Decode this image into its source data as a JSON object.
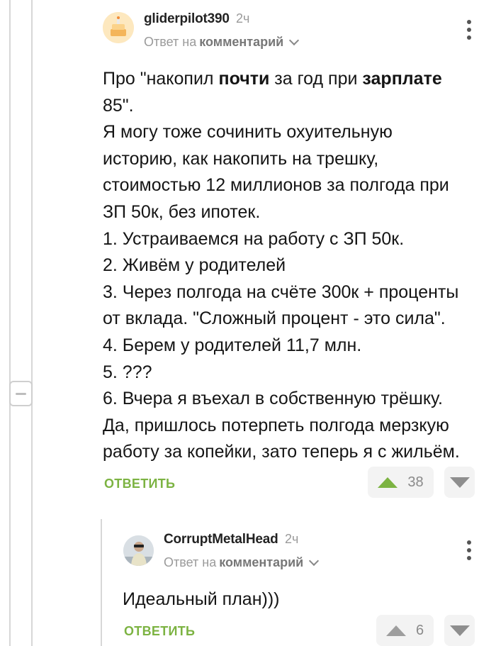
{
  "comment1": {
    "username": "gliderpilot390",
    "time": "2ч",
    "reply_prefix": "Ответ на",
    "reply_target": "комментарий",
    "body_lines": [
      {
        "parts": [
          {
            "t": "Про \"накопил ",
            "b": false
          },
          {
            "t": "почти",
            "b": true
          },
          {
            "t": " за год при ",
            "b": false
          },
          {
            "t": "зарплате",
            "b": true
          }
        ]
      },
      {
        "parts": [
          {
            "t": "85\".",
            "b": false
          }
        ]
      },
      {
        "parts": [
          {
            "t": "Я могу тоже сочинить охуительную",
            "b": false
          }
        ]
      },
      {
        "parts": [
          {
            "t": "историю, как накопить на трешку,",
            "b": false
          }
        ]
      },
      {
        "parts": [
          {
            "t": "стоимостью 12 миллионов за полгода при",
            "b": false
          }
        ]
      },
      {
        "parts": [
          {
            "t": "ЗП 50к, без ипотек.",
            "b": false
          }
        ]
      },
      {
        "parts": [
          {
            "t": "1. Устраиваемся на работу с ЗП 50к.",
            "b": false
          }
        ]
      },
      {
        "parts": [
          {
            "t": "2. Живём у родителей",
            "b": false
          }
        ]
      },
      {
        "parts": [
          {
            "t": "3. Через полгода на счёте 300к + проценты",
            "b": false
          }
        ]
      },
      {
        "parts": [
          {
            "t": "от вклада. \"Сложный процент - это сила\".",
            "b": false
          }
        ]
      },
      {
        "parts": [
          {
            "t": "4. Берем у родителей 11,7 млн.",
            "b": false
          }
        ]
      },
      {
        "parts": [
          {
            "t": "5. ???",
            "b": false
          }
        ]
      },
      {
        "parts": [
          {
            "t": "6. Вчера я въехал в собственную трёшку.",
            "b": false
          }
        ]
      },
      {
        "parts": [
          {
            "t": "Да, пришлось потерпеть полгода мерзкую",
            "b": false
          }
        ]
      },
      {
        "parts": [
          {
            "t": "работу за копейки, зато теперь я с жильём.",
            "b": false
          }
        ]
      }
    ],
    "reply_label": "ОТВЕТИТЬ",
    "score": "38"
  },
  "comment2": {
    "username": "CorruptMetalHead",
    "time": "2ч",
    "reply_prefix": "Ответ на",
    "reply_target": "комментарий",
    "body": "Идеальный план)))",
    "reply_label": "ОТВЕТИТЬ",
    "score": "6"
  },
  "colors": {
    "accent_green": "#7cb342",
    "muted_text": "#9a9a9a",
    "thread_line": "#d7d7d7"
  },
  "icons": [
    "avatar-cake-icon",
    "avatar-person-icon",
    "kebab-menu-icon",
    "chevron-down-icon",
    "collapse-minus-icon",
    "upvote-icon",
    "downvote-icon"
  ]
}
